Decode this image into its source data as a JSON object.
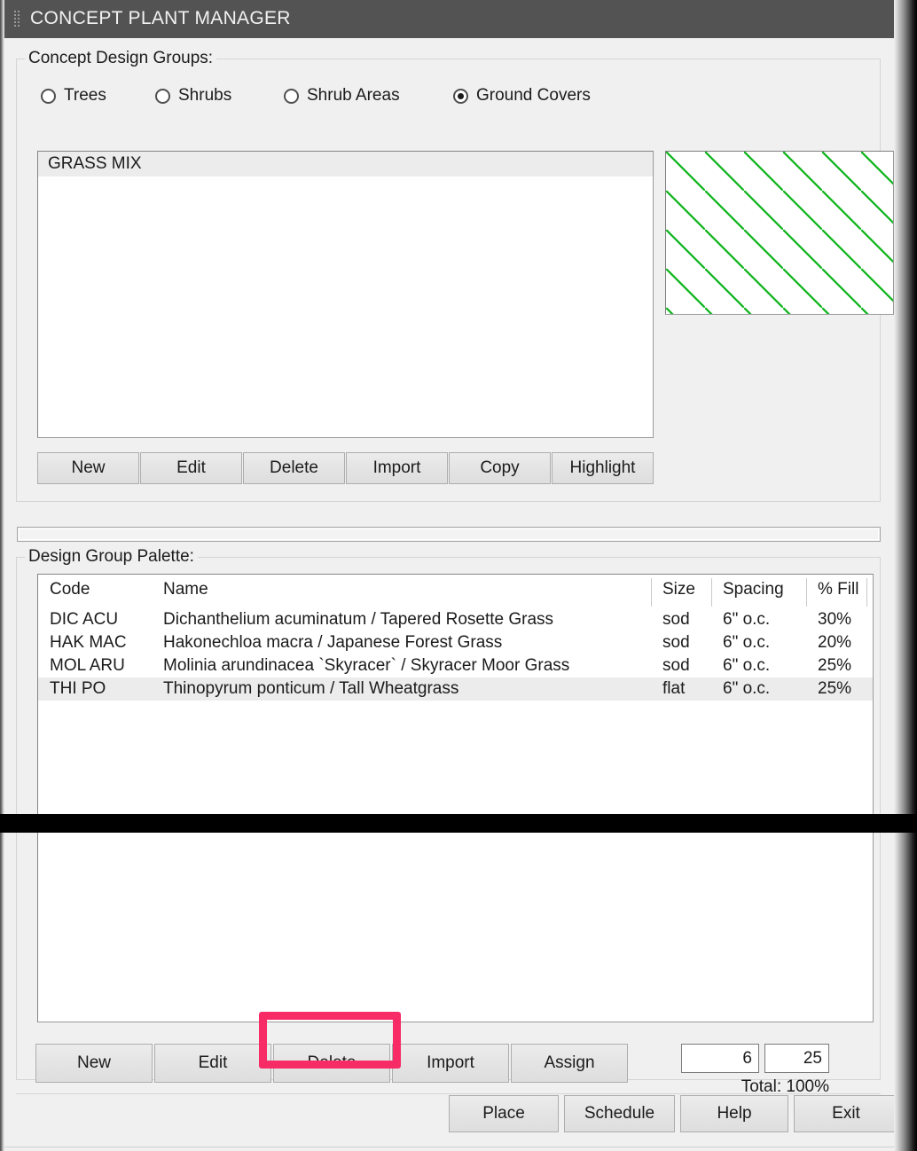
{
  "window": {
    "title": "CONCEPT PLANT MANAGER",
    "grip_icon": "drag-grip-icon"
  },
  "concept_groups": {
    "legend": "Concept Design Groups:",
    "radios": [
      {
        "label": "Trees",
        "checked": false
      },
      {
        "label": "Shrubs",
        "checked": false
      },
      {
        "label": "Shrub Areas",
        "checked": false
      },
      {
        "label": "Ground Covers",
        "checked": true
      }
    ],
    "list": [
      {
        "label": "GRASS MIX",
        "selected": true
      }
    ],
    "preview": {
      "name": "hatch-preview",
      "pattern": "diagonal-lines",
      "color": "#12b520"
    },
    "buttons": [
      "New",
      "Edit",
      "Delete",
      "Import",
      "Copy",
      "Highlight"
    ]
  },
  "palette": {
    "legend": "Design Group Palette:",
    "columns": [
      "Code",
      "Name",
      "Size",
      "Spacing",
      "% Fill",
      ""
    ],
    "rows": [
      {
        "code": "DIC ACU",
        "name": "Dichanthelium acuminatum / Tapered Rosette Grass",
        "size": "sod",
        "spacing": "6\" o.c.",
        "fill": "30%",
        "extra": "",
        "selected": false
      },
      {
        "code": "HAK MAC",
        "name": "Hakonechloa macra / Japanese Forest Grass",
        "size": "sod",
        "spacing": "6\" o.c.",
        "fill": "20%",
        "extra": "",
        "selected": false
      },
      {
        "code": "MOL ARU",
        "name": "Molinia arundinacea `Skyracer` / Skyracer Moor Grass",
        "size": "sod",
        "spacing": "6\" o.c.",
        "fill": "25%",
        "extra": "",
        "selected": false
      },
      {
        "code": "THI  PO",
        "name": "Thinopyrum  ponticum / Tall Wheatgrass",
        "size": "flat",
        "spacing": "6\" o.c.",
        "fill": "25%",
        "extra": "",
        "selected": true
      }
    ],
    "buttons": [
      "New",
      "Edit",
      "Delete",
      "Import",
      "Assign"
    ],
    "highlighted_button": "Delete",
    "highlight_color": "#f72b65",
    "spacing_value": "6",
    "fill_value": "25",
    "total_label": "Total: 100%"
  },
  "footer": {
    "buttons": [
      "Place",
      "Schedule",
      "Help",
      "Exit"
    ]
  }
}
